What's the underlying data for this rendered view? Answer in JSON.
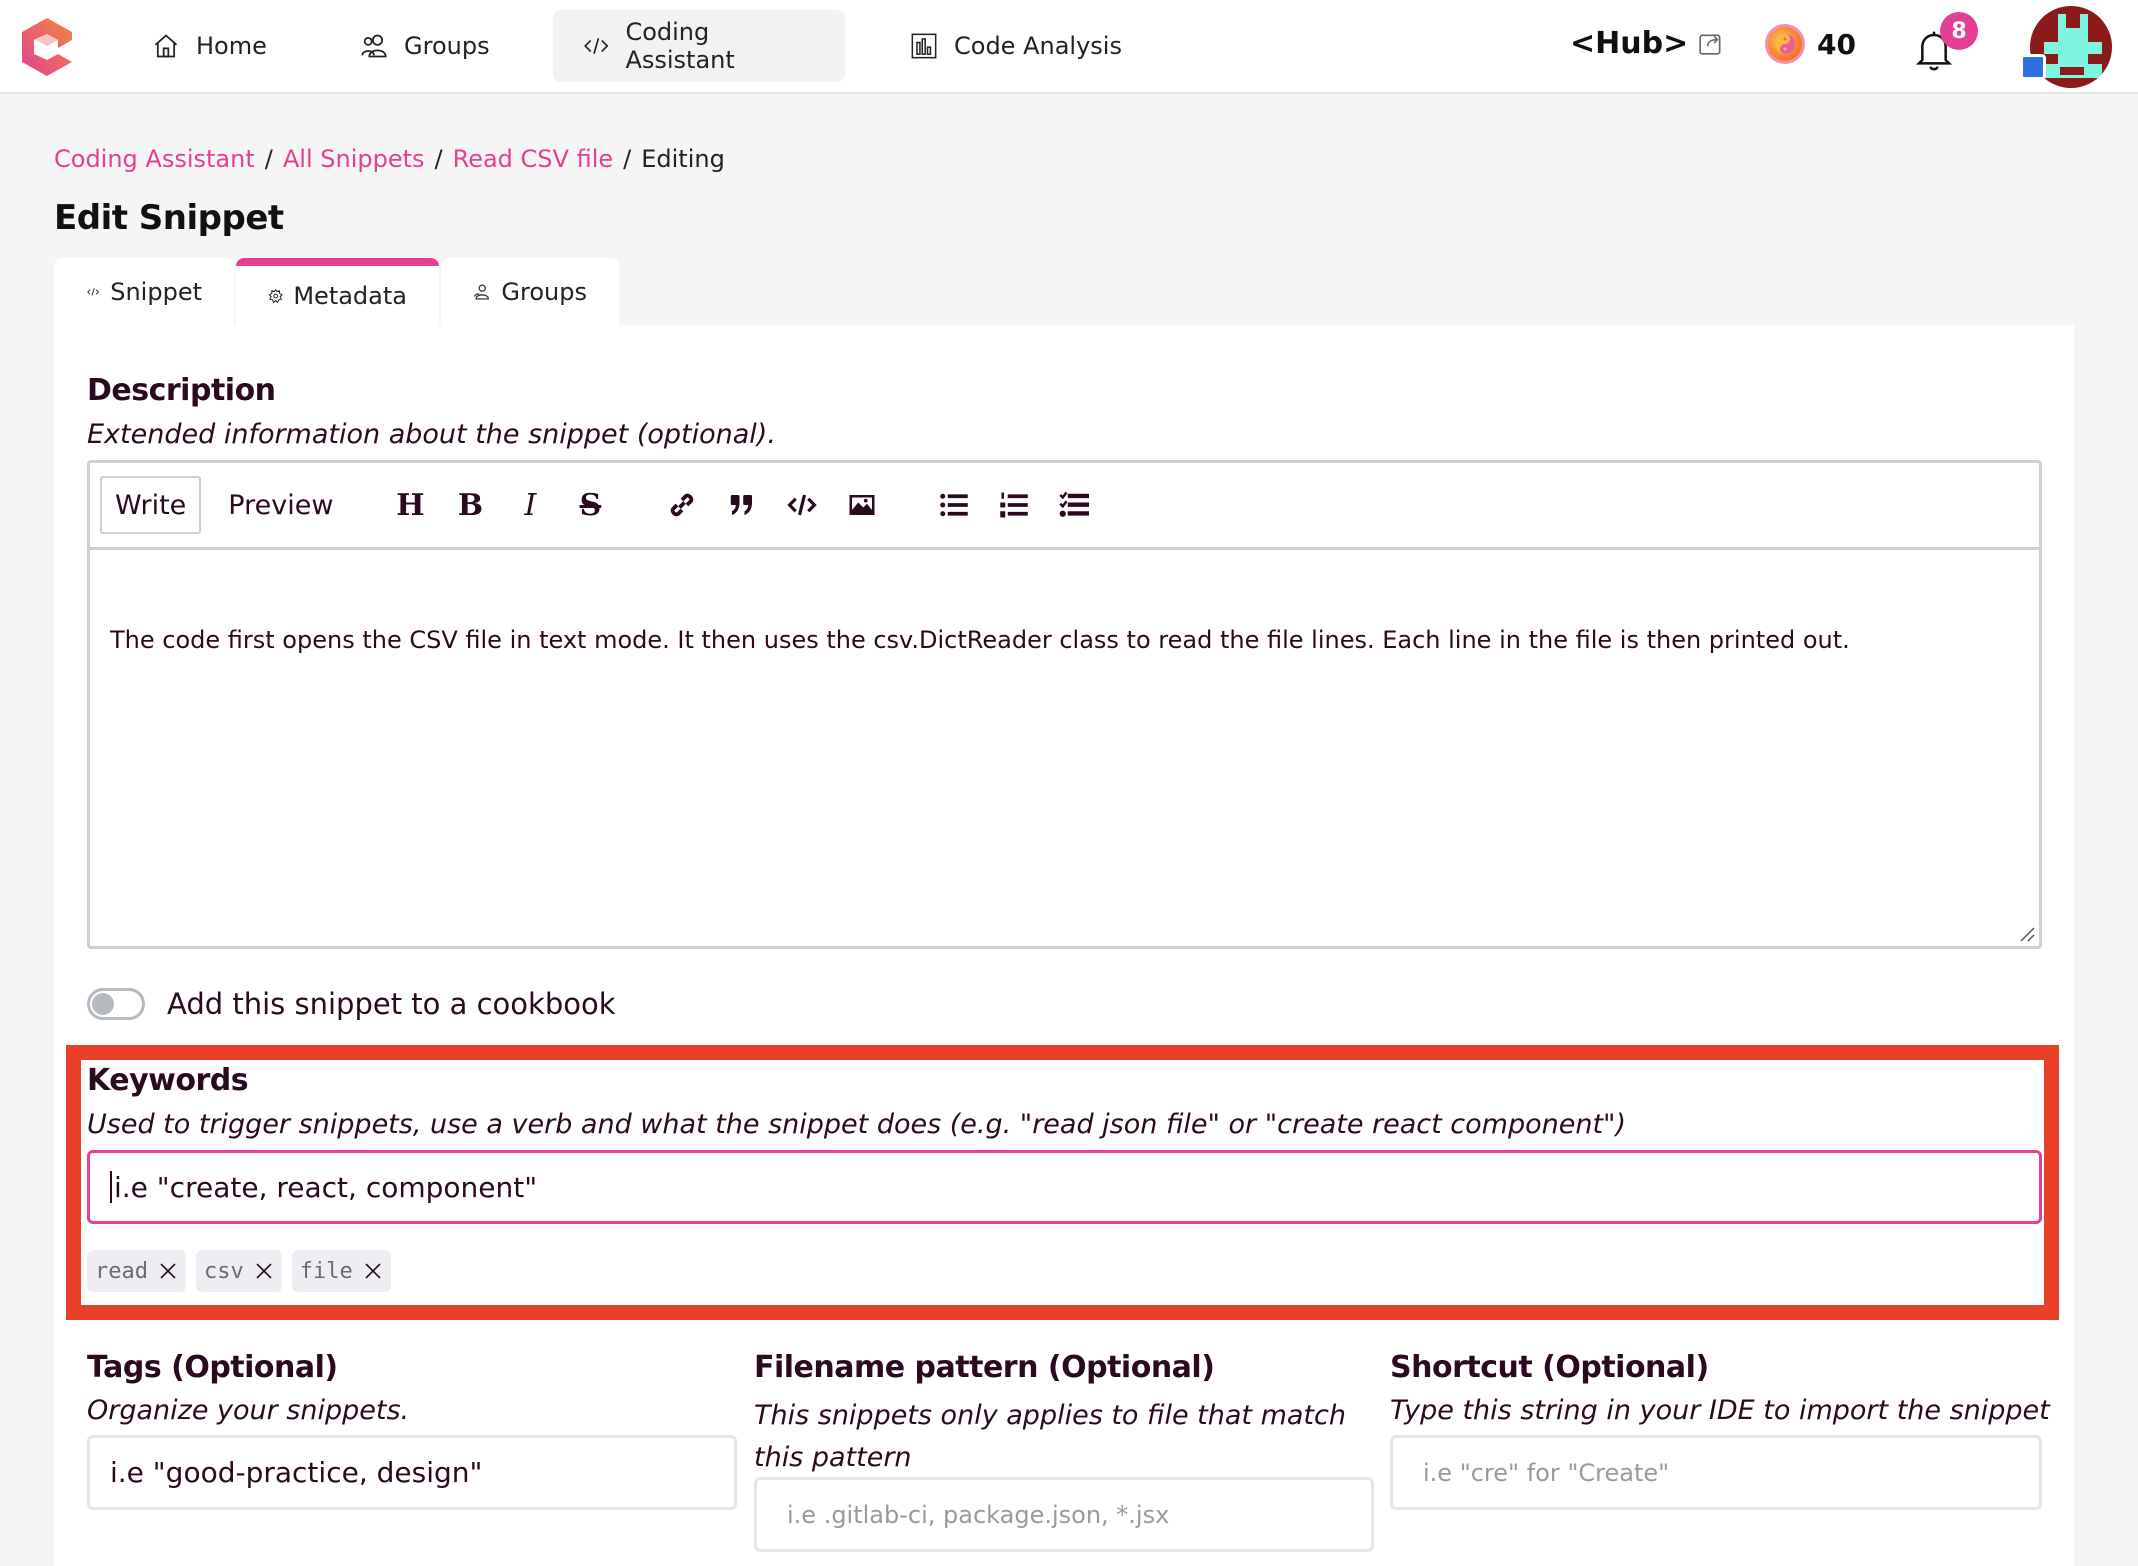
{
  "nav": {
    "items": [
      {
        "label": "Home",
        "icon": "home-icon"
      },
      {
        "label": "Groups",
        "icon": "users-icon"
      },
      {
        "label": "Coding Assistant",
        "icon": "code-icon",
        "active": true
      },
      {
        "label": "Code Analysis",
        "icon": "chart-icon"
      }
    ],
    "hub_label": "<Hub>",
    "coins": "40",
    "notifications": "8"
  },
  "breadcrumb": {
    "items": [
      "Coding Assistant",
      "All Snippets",
      "Read CSV file"
    ],
    "separator": "/",
    "current": "Editing"
  },
  "page_title": "Edit Snippet",
  "tabs": [
    {
      "label": "Snippet",
      "icon": "code-icon"
    },
    {
      "label": "Metadata",
      "icon": "gear-icon",
      "active": true
    },
    {
      "label": "Groups",
      "icon": "users-icon"
    }
  ],
  "description": {
    "label": "Description",
    "help": "Extended information about the snippet (optional).",
    "modes": [
      "Write",
      "Preview"
    ],
    "active_mode": "Write",
    "toolbar": [
      "heading",
      "bold",
      "italic",
      "strikethrough",
      "link",
      "quote",
      "code",
      "image",
      "unordered-list",
      "ordered-list",
      "task-list"
    ],
    "value": "The code first opens the CSV file in text mode. It then uses the csv.DictReader class to read the file lines. Each line in the file is then printed out."
  },
  "cookbook_toggle": {
    "label": "Add this snippet to a cookbook",
    "on": false
  },
  "keywords": {
    "label": "Keywords",
    "help": "Used to trigger snippets, use a verb and what the snippet does (e.g. \"read json file\" or \"create react component\")",
    "placeholder": "i.e \"create, react, component\"",
    "chips": [
      "read",
      "csv",
      "file"
    ]
  },
  "tags": {
    "label": "Tags (Optional)",
    "help": "Organize your snippets.",
    "placeholder": "i.e \"good-practice, design\""
  },
  "filename_pattern": {
    "label": "Filename pattern (Optional)",
    "help": "This snippets only applies to file that match this pattern",
    "placeholder": "i.e .gitlab-ci, package.json, *.jsx"
  },
  "shortcut": {
    "label": "Shortcut (Optional)",
    "help": "Type this string in your IDE to import the snippet",
    "placeholder": "i.e \"cre\" for \"Create\""
  },
  "colors": {
    "accent": "#e23f95",
    "highlight": "#e84127",
    "text": "#2a0a1e",
    "page_bg": "#f5f5f5"
  }
}
